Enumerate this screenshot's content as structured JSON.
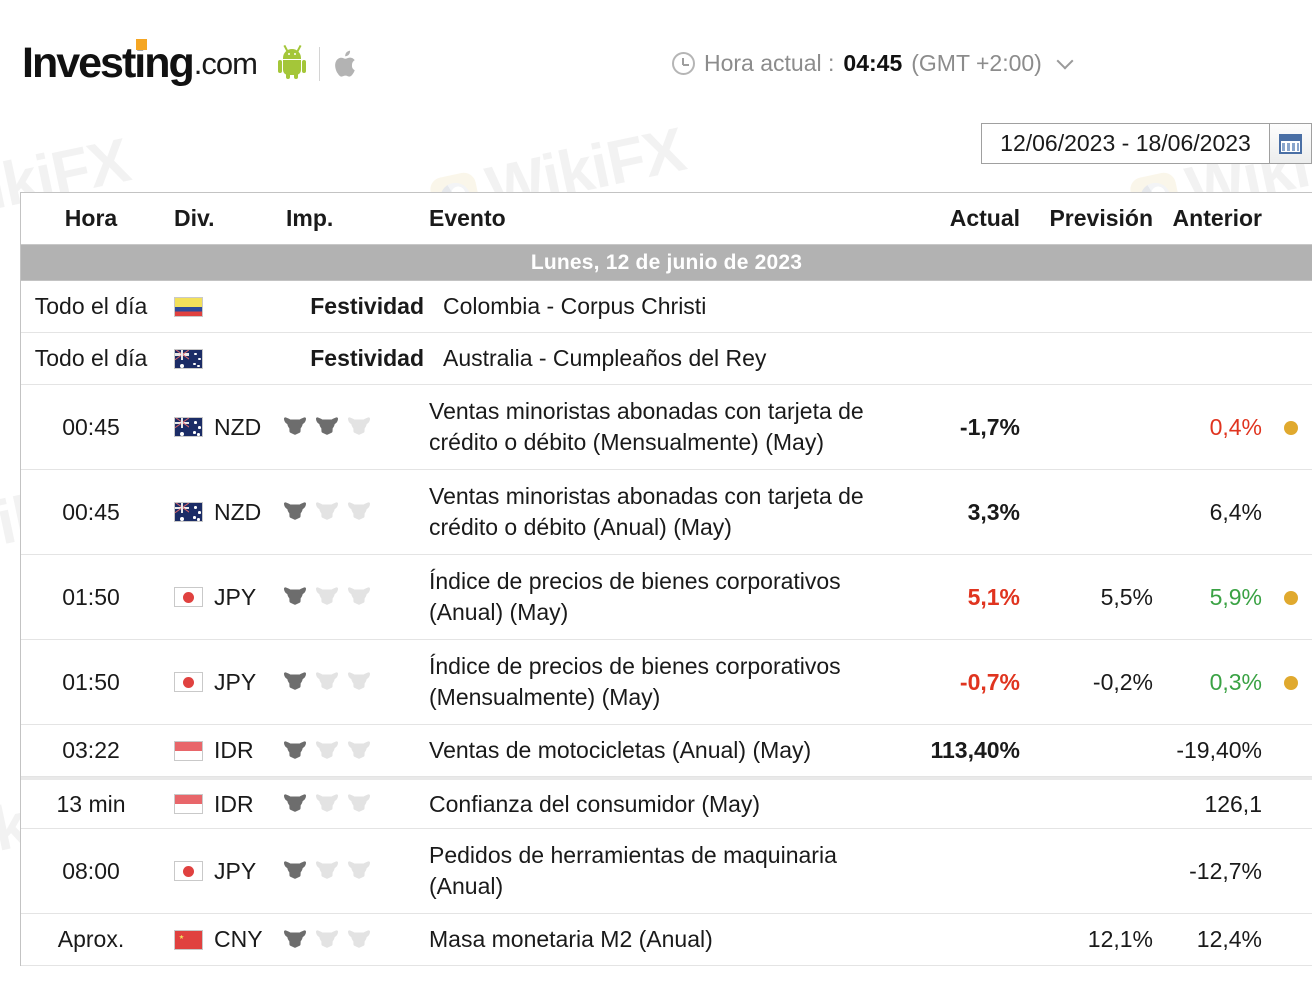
{
  "header": {
    "logo_main": "Invest",
    "logo_main2": "ing",
    "logo_suffix": ".com",
    "android_icon": "android-icon",
    "apple_icon": "apple-icon",
    "clock_icon": "clock-icon",
    "time_label": "Hora actual :",
    "time_value": "04:45",
    "timezone": "(GMT +2:00)",
    "chevron_icon": "chevron-down-icon"
  },
  "datepicker": {
    "range": "12/06/2023 - 18/06/2023",
    "calendar_icon": "calendar-icon"
  },
  "table": {
    "columns": {
      "hora": "Hora",
      "div": "Div.",
      "imp": "Imp.",
      "evento": "Evento",
      "actual": "Actual",
      "prevision": "Previsión",
      "anterior": "Anterior"
    },
    "day_band": "Lunes, 12 de junio de 2023",
    "rows": [
      {
        "time": "Todo el día",
        "flag": "co",
        "currency": "",
        "importance": 0,
        "holiday_label": "Festividad",
        "event": "Colombia - Corpus Christi",
        "actual": "",
        "prevision": "",
        "anterior": "",
        "dot": false,
        "actual_color": "black",
        "anterior_color": "black",
        "height": "h1"
      },
      {
        "time": "Todo el día",
        "flag": "au",
        "currency": "",
        "importance": 0,
        "holiday_label": "Festividad",
        "event": "Australia - Cumpleaños del Rey",
        "actual": "",
        "prevision": "",
        "anterior": "",
        "dot": false,
        "actual_color": "black",
        "anterior_color": "black",
        "height": "h1"
      },
      {
        "time": "00:45",
        "flag": "nz",
        "currency": "NZD",
        "importance": 2,
        "holiday_label": "",
        "event": "Ventas minoristas abonadas con tarjeta de crédito o débito (Mensualmente) (May)",
        "actual": "-1,7%",
        "prevision": "",
        "anterior": "0,4%",
        "dot": true,
        "actual_color": "black",
        "anterior_color": "red",
        "height": "h2"
      },
      {
        "time": "00:45",
        "flag": "nz",
        "currency": "NZD",
        "importance": 1,
        "holiday_label": "",
        "event": "Ventas minoristas abonadas con tarjeta de crédito o débito (Anual) (May)",
        "actual": "3,3%",
        "prevision": "",
        "anterior": "6,4%",
        "dot": false,
        "actual_color": "black",
        "anterior_color": "black",
        "height": "h2"
      },
      {
        "time": "01:50",
        "flag": "jp",
        "currency": "JPY",
        "importance": 1,
        "holiday_label": "",
        "event": "Índice de precios de bienes corporativos (Anual) (May)",
        "actual": "5,1%",
        "prevision": "5,5%",
        "anterior": "5,9%",
        "dot": true,
        "actual_color": "red",
        "anterior_color": "green",
        "height": "h2"
      },
      {
        "time": "01:50",
        "flag": "jp",
        "currency": "JPY",
        "importance": 1,
        "holiday_label": "",
        "event": "Índice de precios de bienes corporativos (Mensualmente) (May)",
        "actual": "-0,7%",
        "prevision": "-0,2%",
        "anterior": "0,3%",
        "dot": true,
        "actual_color": "red",
        "anterior_color": "green",
        "height": "h2"
      },
      {
        "time": "03:22",
        "flag": "id",
        "currency": "IDR",
        "importance": 1,
        "holiday_label": "",
        "event": "Ventas de motocicletas (Anual) (May)",
        "actual": "113,40%",
        "prevision": "",
        "anterior": "-19,40%",
        "dot": false,
        "actual_color": "black",
        "anterior_color": "black",
        "height": "h1"
      },
      {
        "time": "13 min",
        "flag": "id",
        "currency": "IDR",
        "importance": 1,
        "holiday_label": "",
        "event": "Confianza del consumidor (May)",
        "actual": "",
        "prevision": "",
        "anterior": "126,1",
        "dot": false,
        "actual_color": "black",
        "anterior_color": "black",
        "height": "h1",
        "thick_sep": true
      },
      {
        "time": "08:00",
        "flag": "jp",
        "currency": "JPY",
        "importance": 1,
        "holiday_label": "",
        "event": "Pedidos de herramientas de maquinaria (Anual)",
        "actual": "",
        "prevision": "",
        "anterior": "-12,7%",
        "dot": false,
        "actual_color": "black",
        "anterior_color": "black",
        "height": "h2"
      },
      {
        "time": "Aprox.",
        "flag": "cn",
        "currency": "CNY",
        "importance": 1,
        "holiday_label": "",
        "event": "Masa monetaria M2 (Anual)",
        "actual": "",
        "prevision": "12,1%",
        "anterior": "12,4%",
        "dot": false,
        "actual_color": "black",
        "anterior_color": "black",
        "height": "h1"
      }
    ]
  },
  "watermark": {
    "text": "WikiFX"
  },
  "colors": {
    "accent_orange": "#f5a623",
    "negative_red": "#e0341f",
    "positive_green": "#3aa244",
    "dot_gold": "#e0a92e",
    "band_gray": "#b2b2b2"
  }
}
